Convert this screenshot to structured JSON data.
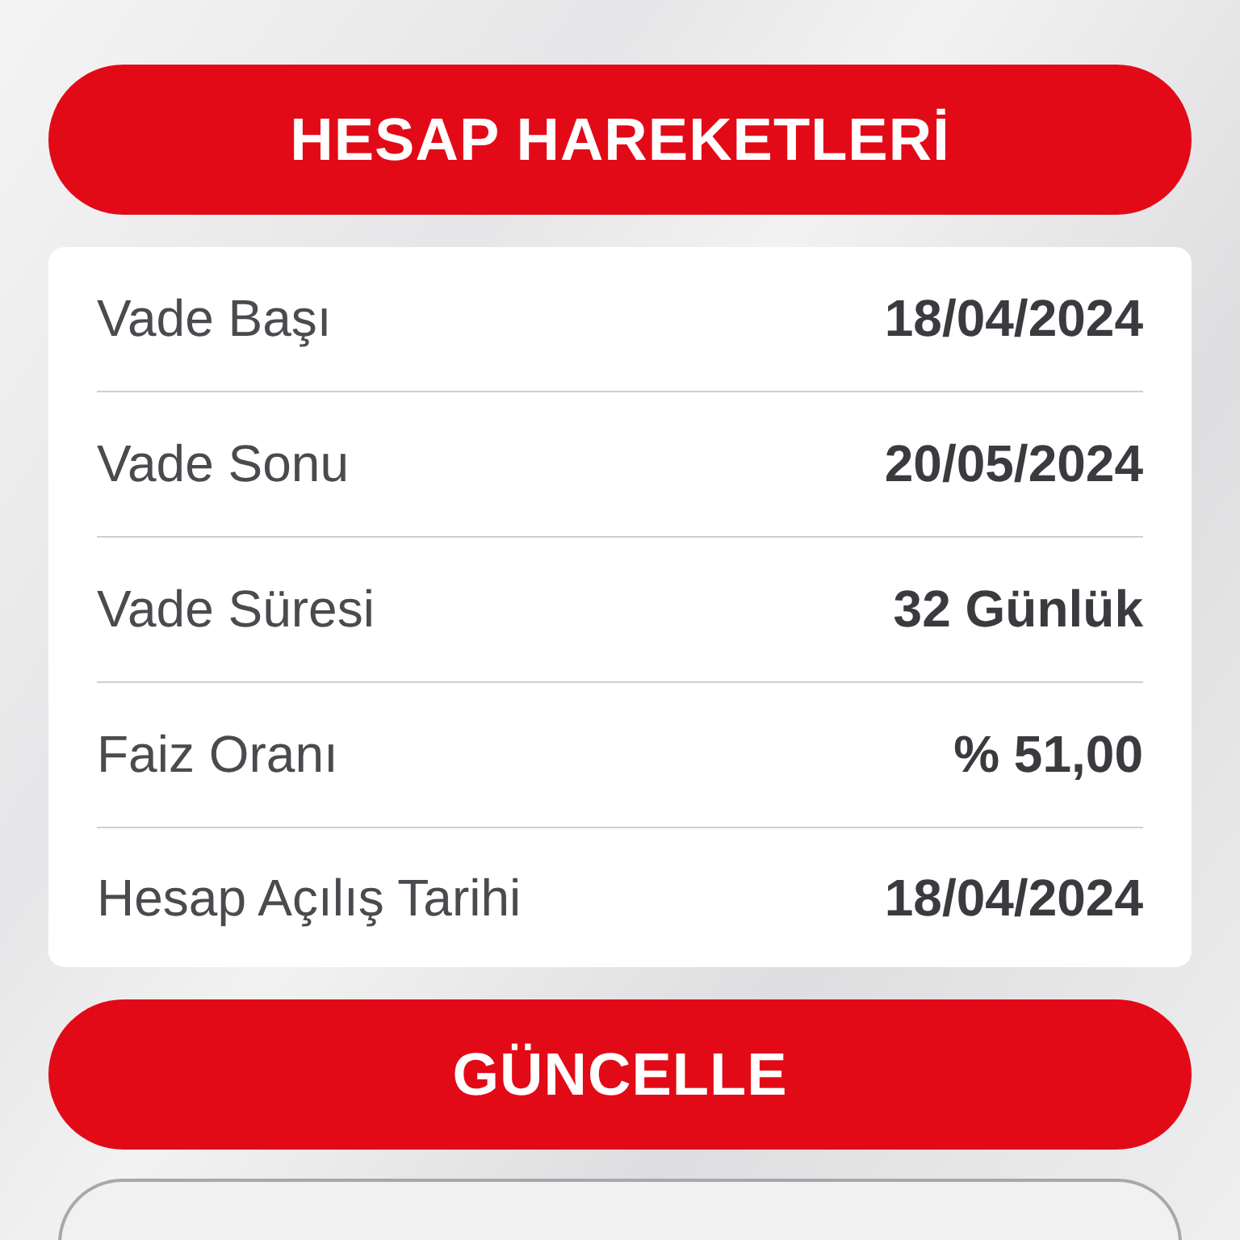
{
  "header_button": {
    "label": "HESAP HAREKETLERİ"
  },
  "details": [
    {
      "label": "Vade Başı",
      "value": "18/04/2024"
    },
    {
      "label": "Vade Sonu",
      "value": "20/05/2024"
    },
    {
      "label": "Vade Süresi",
      "value": "32 Günlük"
    },
    {
      "label": "Faiz Oranı",
      "value": "% 51,00"
    },
    {
      "label": "Hesap Açılış Tarihi",
      "value": "18/04/2024"
    }
  ],
  "update_button": {
    "label": "GÜNCELLE"
  }
}
